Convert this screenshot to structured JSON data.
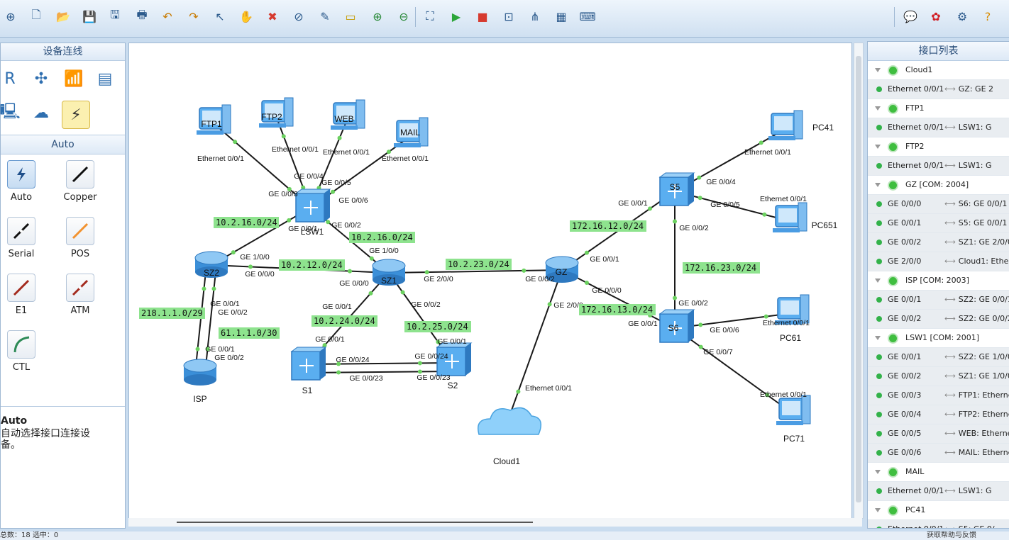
{
  "toolbar": {
    "icons": [
      "new-topology-icon",
      "new-file-icon",
      "open-icon",
      "save-icon",
      "save-as-icon",
      "print-icon",
      "undo-icon",
      "redo-icon",
      "select-icon",
      "hand-icon",
      "delete-icon",
      "delete-link-icon",
      "text-icon",
      "rectangle-icon",
      "zoom-in-icon",
      "zoom-out-icon",
      "fit-icon",
      "start-icon",
      "stop-icon",
      "capture-icon",
      "topology-icon",
      "grid-icon",
      "console-icon"
    ],
    "right_icons": [
      "chat-icon",
      "huawei-icon",
      "settings-icon",
      "help-icon"
    ]
  },
  "left_panel": {
    "title": "设备连线",
    "devices": [
      "router-icon",
      "switch-icon",
      "wireless-icon",
      "firewall-icon",
      "pc-icon",
      "cloud-icon",
      "cable-icon"
    ],
    "section_title": "Auto",
    "cables": [
      {
        "label": "Auto",
        "color": "#1f4f8a"
      },
      {
        "label": "Copper",
        "color": "#111111"
      },
      {
        "label": "Serial",
        "color": "#111111"
      },
      {
        "label": "POS",
        "color": "#f2922f"
      },
      {
        "label": "E1",
        "color": "#a32a1d"
      },
      {
        "label": "ATM",
        "color": "#a32a1d"
      },
      {
        "label": "CTL",
        "color": "#2e8b57"
      }
    ],
    "desc_title": "Auto",
    "desc_text": "自动选择接口连接设备。"
  },
  "right_panel": {
    "title": "接口列表",
    "rows": [
      {
        "type": "dev",
        "text": "Cloud1"
      },
      {
        "type": "port",
        "a": "Ethernet 0/0/1",
        "b": "GZ: GE 2"
      },
      {
        "type": "dev",
        "text": "FTP1"
      },
      {
        "type": "port",
        "a": "Ethernet 0/0/1",
        "b": "LSW1: G"
      },
      {
        "type": "dev",
        "text": "FTP2"
      },
      {
        "type": "port",
        "a": "Ethernet 0/0/1",
        "b": "LSW1: G"
      },
      {
        "type": "dev",
        "text": "GZ [COM: 2004]"
      },
      {
        "type": "port",
        "a": "GE 0/0/0",
        "b": "S6: GE 0/0/1"
      },
      {
        "type": "port",
        "a": "GE 0/0/1",
        "b": "S5: GE 0/0/1"
      },
      {
        "type": "port",
        "a": "GE 0/0/2",
        "b": "SZ1: GE 2/0/0"
      },
      {
        "type": "port",
        "a": "GE 2/0/0",
        "b": "Cloud1: Ethern"
      },
      {
        "type": "dev",
        "text": "ISP [COM: 2003]"
      },
      {
        "type": "port",
        "a": "GE 0/0/1",
        "b": "SZ2: GE 0/0/1"
      },
      {
        "type": "port",
        "a": "GE 0/0/2",
        "b": "SZ2: GE 0/0/2"
      },
      {
        "type": "dev",
        "text": "LSW1 [COM: 2001]"
      },
      {
        "type": "port",
        "a": "GE 0/0/1",
        "b": "SZ2: GE 1/0/0"
      },
      {
        "type": "port",
        "a": "GE 0/0/2",
        "b": "SZ1: GE 1/0/0"
      },
      {
        "type": "port",
        "a": "GE 0/0/3",
        "b": "FTP1: Ethernet"
      },
      {
        "type": "port",
        "a": "GE 0/0/4",
        "b": "FTP2: Ethernet"
      },
      {
        "type": "port",
        "a": "GE 0/0/5",
        "b": "WEB: Ethernet"
      },
      {
        "type": "port",
        "a": "GE 0/0/6",
        "b": "MAIL: Etherne"
      },
      {
        "type": "dev",
        "text": "MAIL"
      },
      {
        "type": "port",
        "a": "Ethernet 0/0/1",
        "b": "LSW1: G"
      },
      {
        "type": "dev",
        "text": "PC41"
      },
      {
        "type": "port",
        "a": "Ethernet 0/0/1",
        "b": "S5: GE 0/"
      }
    ]
  },
  "topology": {
    "nodes": [
      {
        "id": "FTP1",
        "label": "FTP1",
        "type": "pc"
      },
      {
        "id": "FTP2",
        "label": "FTP2",
        "type": "pc"
      },
      {
        "id": "WEB",
        "label": "WEB",
        "type": "pc"
      },
      {
        "id": "MAIL",
        "label": "MAIL",
        "type": "pc"
      },
      {
        "id": "LSW1",
        "label": "LSW1",
        "type": "switch"
      },
      {
        "id": "SZ2",
        "label": "SZ2",
        "type": "router"
      },
      {
        "id": "SZ1",
        "label": "SZ1",
        "type": "router"
      },
      {
        "id": "ISP",
        "label": "ISP",
        "type": "router"
      },
      {
        "id": "S1",
        "label": "S1",
        "type": "switch"
      },
      {
        "id": "S2",
        "label": "S2",
        "type": "switch"
      },
      {
        "id": "GZ",
        "label": "GZ",
        "type": "router"
      },
      {
        "id": "Cloud1",
        "label": "Cloud1",
        "type": "cloud"
      },
      {
        "id": "S5",
        "label": "S5",
        "type": "switch"
      },
      {
        "id": "S6",
        "label": "S6",
        "type": "switch"
      },
      {
        "id": "PC41",
        "label": "PC41",
        "type": "pc"
      },
      {
        "id": "PC651",
        "label": "PC651",
        "type": "pc"
      },
      {
        "id": "PC61",
        "label": "PC61",
        "type": "pc"
      },
      {
        "id": "PC71",
        "label": "PC71",
        "type": "pc"
      }
    ],
    "links": [
      {
        "a": "FTP1",
        "b": "LSW1"
      },
      {
        "a": "FTP2",
        "b": "LSW1"
      },
      {
        "a": "WEB",
        "b": "LSW1"
      },
      {
        "a": "MAIL",
        "b": "LSW1"
      },
      {
        "a": "LSW1",
        "b": "SZ2"
      },
      {
        "a": "LSW1",
        "b": "SZ1"
      },
      {
        "a": "SZ2",
        "b": "SZ1"
      },
      {
        "a": "SZ2",
        "b": "ISP"
      },
      {
        "a": "SZ2",
        "b": "ISP",
        "second": true
      },
      {
        "a": "SZ1",
        "b": "S1"
      },
      {
        "a": "SZ1",
        "b": "S2"
      },
      {
        "a": "S1",
        "b": "S2"
      },
      {
        "a": "S1",
        "b": "S2",
        "second": true
      },
      {
        "a": "SZ1",
        "b": "GZ"
      },
      {
        "a": "GZ",
        "b": "Cloud1"
      },
      {
        "a": "GZ",
        "b": "S5"
      },
      {
        "a": "GZ",
        "b": "S6"
      },
      {
        "a": "S5",
        "b": "S6"
      },
      {
        "a": "S5",
        "b": "PC41"
      },
      {
        "a": "S5",
        "b": "PC651"
      },
      {
        "a": "S6",
        "b": "PC61"
      },
      {
        "a": "S6",
        "b": "PC71"
      }
    ],
    "port_labels": [
      "Ethernet 0/0/1",
      "Ethernet 0/0/1",
      "Ethernet 0/0/1",
      "Ethernet 0/0/1",
      "GE 0/0/4",
      "GE 0/0/5",
      "GE 0/0/3",
      "GE 0/0/6",
      "GE 0/0/1",
      "GE 0/0/2",
      "GE 1/0/0",
      "GE 1/0/0",
      "GE 0/0/0",
      "GE 0/0/0",
      "GE 2/0/0",
      "GE 0/0/1",
      "GE 0/0/2",
      "GE 0/0/1",
      "GE 0/0/2",
      "GE 0/0/1",
      "GE 0/0/2",
      "GE 0/0/1",
      "GE 0/0/1",
      "GE 0/0/24",
      "GE 0/0/23",
      "GE 0/0/24",
      "GE 0/0/23",
      "GE 0/0/2",
      "GE 2/0/0",
      "Ethernet 0/0/1",
      "GE 0/0/1",
      "GE 0/0/1",
      "GE 0/0/0",
      "GE 0/0/1",
      "GE 0/0/4",
      "GE 0/0/5",
      "GE 0/0/2",
      "GE 0/0/2",
      "GE 0/0/6",
      "GE 0/0/7",
      "Ethernet 0/0/1",
      "Ethernet 0/0/1",
      "Ethernet 0/0/1",
      "Ethernet 0/0/1"
    ],
    "subnets": [
      "10.2.16.0/24",
      "10.2.16.0/24",
      "10.2.12.0/24",
      "10.2.23.0/24",
      "218.1.1.0/29",
      "61.1.1.0/30",
      "10.2.24.0/24",
      "10.2.25.0/24",
      "172.16.12.0/24",
      "172.16.23.0/24",
      "172.16.13.0/24"
    ]
  },
  "status": {
    "left": "总数：18  选中：0",
    "right": "获取帮助与反馈"
  }
}
